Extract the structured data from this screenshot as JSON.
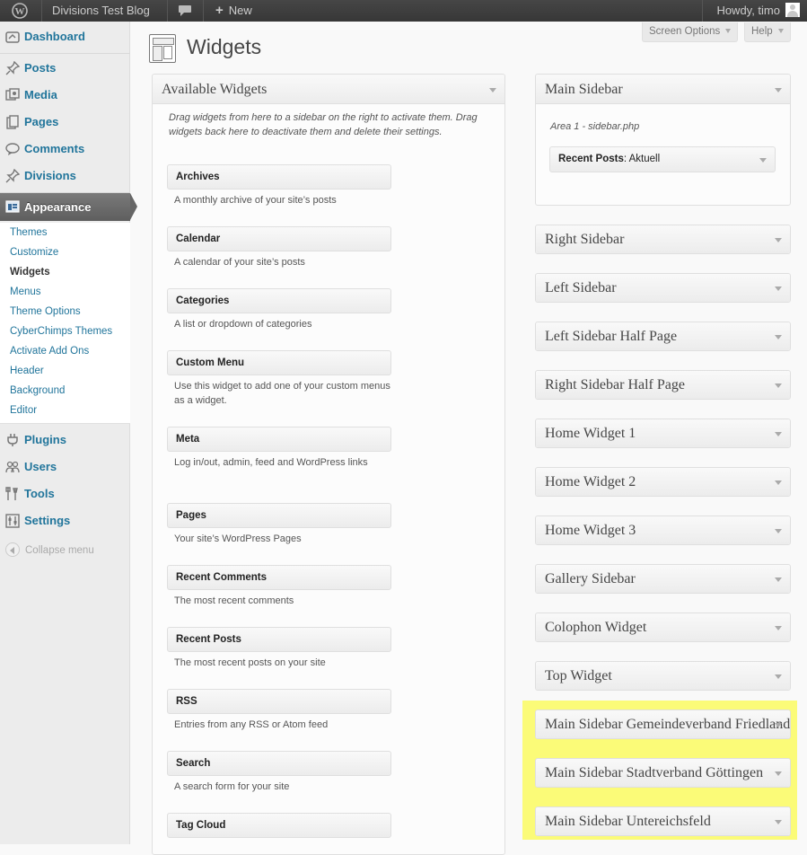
{
  "admin_bar": {
    "site_name": "Divisions Test Blog",
    "new_label": "New",
    "howdy": "Howdy, timo"
  },
  "menu": {
    "items": [
      {
        "label": "Dashboard",
        "icon": "dashboard-icon"
      },
      {
        "label": "Posts",
        "icon": "pin-icon"
      },
      {
        "label": "Media",
        "icon": "media-icon"
      },
      {
        "label": "Pages",
        "icon": "pages-icon"
      },
      {
        "label": "Comments",
        "icon": "comment-icon"
      },
      {
        "label": "Divisions",
        "icon": "pin-icon"
      },
      {
        "label": "Appearance",
        "icon": "appearance-icon"
      },
      {
        "label": "Plugins",
        "icon": "plugin-icon"
      },
      {
        "label": "Users",
        "icon": "users-icon"
      },
      {
        "label": "Tools",
        "icon": "tools-icon"
      },
      {
        "label": "Settings",
        "icon": "settings-icon"
      }
    ],
    "appearance_submenu": [
      "Themes",
      "Customize",
      "Widgets",
      "Menus",
      "Theme Options",
      "CyberChimps Themes",
      "Activate Add Ons",
      "Header",
      "Background",
      "Editor"
    ],
    "current_submenu": "Widgets",
    "collapse_label": "Collapse menu"
  },
  "header": {
    "title": "Widgets",
    "screen_options": "Screen Options",
    "help": "Help"
  },
  "available": {
    "title": "Available Widgets",
    "description": "Drag widgets from here to a sidebar on the right to activate them. Drag widgets back here to deactivate them and delete their settings.",
    "widgets": [
      {
        "title": "Archives",
        "desc": "A monthly archive of your site’s posts"
      },
      {
        "title": "Calendar",
        "desc": "A calendar of your site’s posts"
      },
      {
        "title": "Categories",
        "desc": "A list or dropdown of categories"
      },
      {
        "title": "Custom Menu",
        "desc": "Use this widget to add one of your custom menus as a widget."
      },
      {
        "title": "Meta",
        "desc": "Log in/out, admin, feed and WordPress links"
      },
      {
        "title": "Pages",
        "desc": "Your site’s WordPress Pages"
      },
      {
        "title": "Recent Comments",
        "desc": "The most recent comments"
      },
      {
        "title": "Recent Posts",
        "desc": "The most recent posts on your site"
      },
      {
        "title": "RSS",
        "desc": "Entries from any RSS or Atom feed"
      },
      {
        "title": "Search",
        "desc": "A search form for your site"
      },
      {
        "title": "Tag Cloud",
        "desc": ""
      }
    ]
  },
  "sidebars": {
    "main": {
      "title": "Main Sidebar",
      "area_desc": "Area 1 - sidebar.php",
      "widget_name": "Recent Posts",
      "widget_instance": ": Aktuell"
    },
    "others": [
      "Right Sidebar",
      "Left Sidebar",
      "Left Sidebar Half Page",
      "Right Sidebar Half Page",
      "Home Widget 1",
      "Home Widget 2",
      "Home Widget 3",
      "Gallery Sidebar",
      "Colophon Widget",
      "Top Widget",
      "Main Sidebar Gemeindeverband Friedland",
      "Main Sidebar Stadtverband Göttingen",
      "Main Sidebar Untereichsfeld"
    ],
    "highlighted": [
      "Main Sidebar Gemeindeverband Friedland",
      "Main Sidebar Stadtverband Göttingen",
      "Main Sidebar Untereichsfeld"
    ],
    "highlight_color": "#fbfb78"
  },
  "colors": {
    "link": "#21759b",
    "admin_bar": "#464646"
  }
}
